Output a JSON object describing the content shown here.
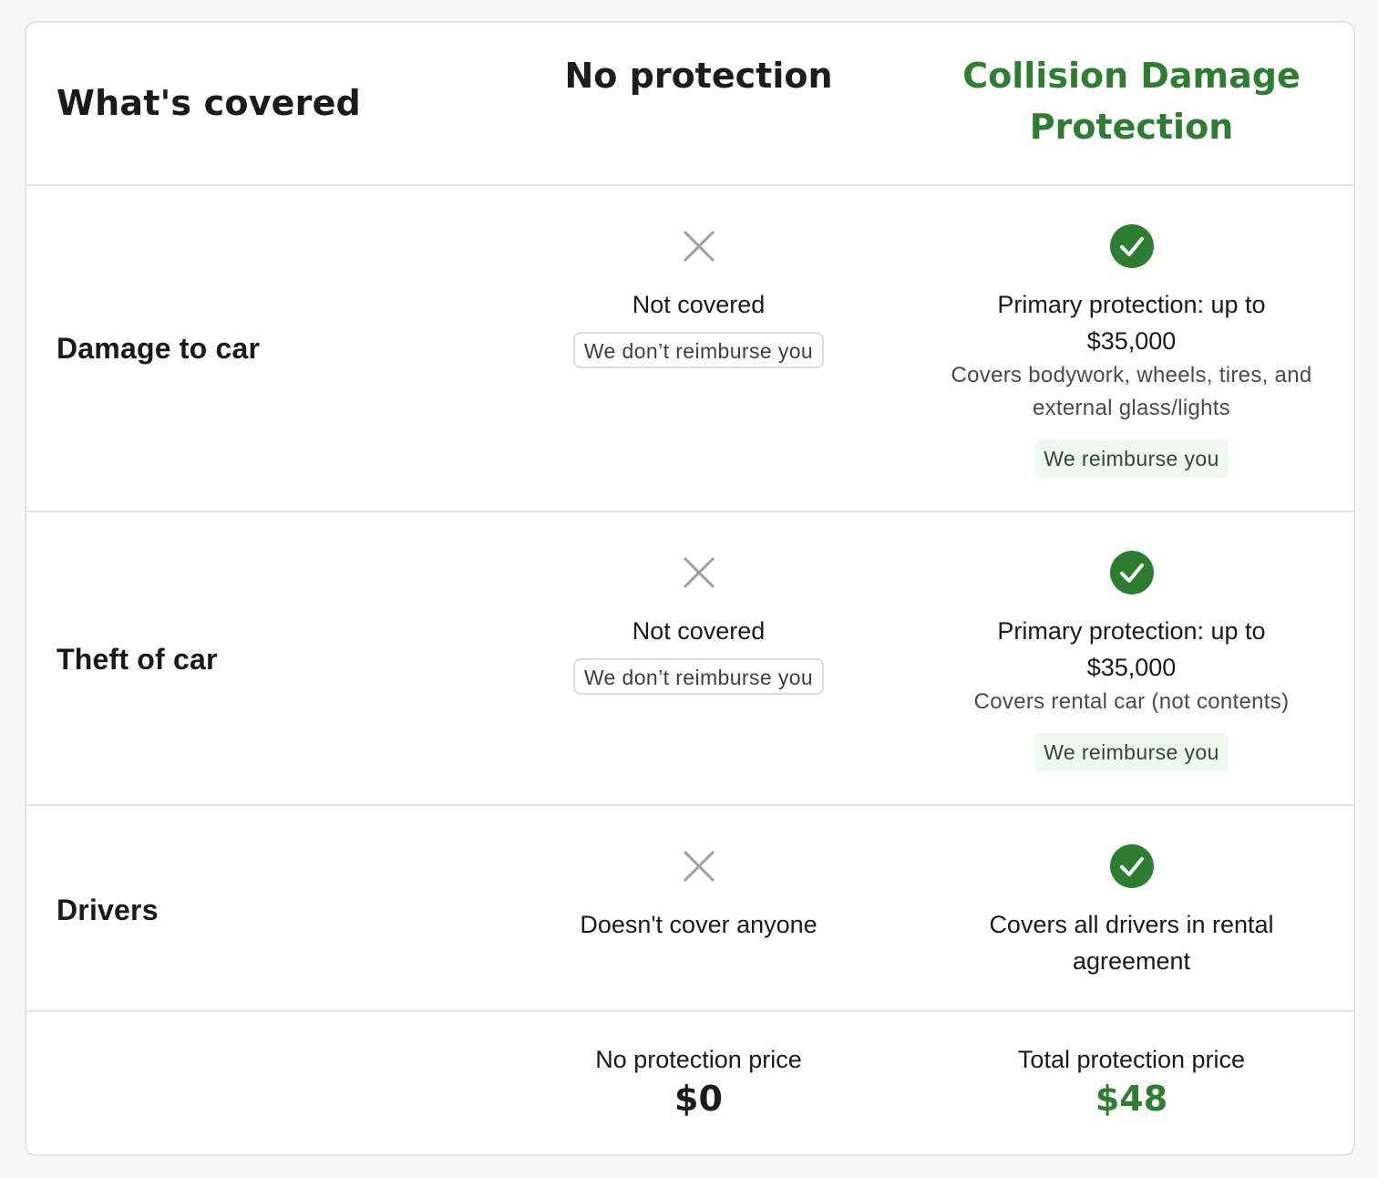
{
  "header": {
    "label": "What's covered",
    "col_no": "No protection",
    "col_cdp": "Collision Damage Protection"
  },
  "rows": [
    {
      "label": "Damage to car",
      "no": {
        "icon": "close-icon",
        "main": "Not covered",
        "pill": "We don’t reimburse you"
      },
      "cdp": {
        "icon": "check-circle-icon",
        "main": "Primary protection: up to $35,000",
        "sub": "Covers bodywork, wheels, tires, and external glass/lights",
        "pill": "We reimburse you"
      }
    },
    {
      "label": "Theft of car",
      "no": {
        "icon": "close-icon",
        "main": "Not covered",
        "pill": "We don’t reimburse you"
      },
      "cdp": {
        "icon": "check-circle-icon",
        "main": "Primary protection: up to $35,000",
        "sub": "Covers rental car (not contents)",
        "pill": "We reimburse you"
      }
    },
    {
      "label": "Drivers",
      "no": {
        "icon": "close-icon",
        "main": "Doesn't cover anyone"
      },
      "cdp": {
        "icon": "check-circle-icon",
        "main": "Covers all drivers in rental agreement"
      }
    }
  ],
  "prices": {
    "no_label": "No protection price",
    "no_value": "$0",
    "cdp_label": "Total protection price",
    "cdp_value": "$48"
  },
  "colors": {
    "accent_green": "#2e7d32",
    "x_gray": "#9e9e9e",
    "pill_green_bg": "#eef8ee",
    "border": "#e4e4e4"
  }
}
